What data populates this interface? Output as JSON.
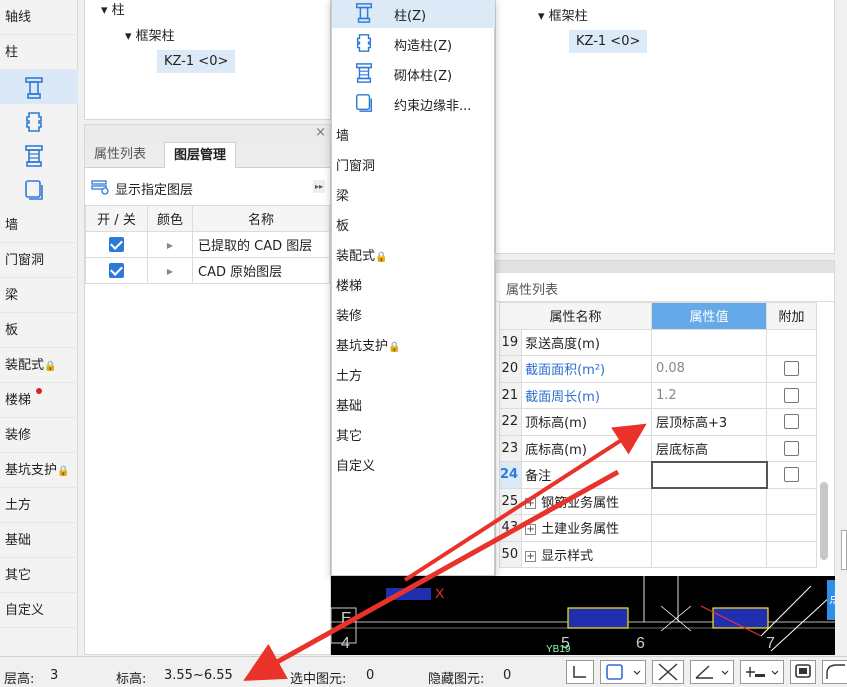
{
  "left_nav": {
    "items": [
      {
        "id": "axis",
        "label": "轴线"
      },
      {
        "id": "column",
        "label": "柱"
      },
      {
        "id": "wall",
        "label": "墙"
      },
      {
        "id": "door-window",
        "label": "门窗洞"
      },
      {
        "id": "beam",
        "label": "梁"
      },
      {
        "id": "slab",
        "label": "板"
      },
      {
        "id": "prefab",
        "label": "装配式",
        "lock": "🔒"
      },
      {
        "id": "stair",
        "label": "楼梯"
      },
      {
        "id": "decoration",
        "label": "装修"
      },
      {
        "id": "pit-support",
        "label": "基坑支护",
        "lock": "🔒"
      },
      {
        "id": "earthwork",
        "label": "土方"
      },
      {
        "id": "foundation",
        "label": "基础"
      },
      {
        "id": "other",
        "label": "其它"
      },
      {
        "id": "custom",
        "label": "自定义"
      }
    ],
    "column_subicons": [
      "column-icon",
      "constructional-column-icon",
      "masonry-column-icon",
      "boundary-member-icon"
    ],
    "accent": "#2f7ad8"
  },
  "left_tree": {
    "root_label": "柱",
    "group_label": "框架柱",
    "selected_item": "KZ-1 <0>"
  },
  "layer_panel": {
    "close_glyph": "×",
    "tabs": [
      "属性列表",
      "图层管理"
    ],
    "active_tab": "图层管理",
    "show_layers_label": "显示指定图层",
    "expand_glyph": "▸▸",
    "columns": [
      "开 / 关",
      "颜色",
      "名称"
    ],
    "rows": [
      {
        "checked": true,
        "name": "已提取的 CAD 图层"
      },
      {
        "checked": true,
        "name": "CAD 原始图层"
      }
    ]
  },
  "popup_menu": {
    "column_items": [
      {
        "label": "柱(Z)",
        "icon": "column-icon",
        "selected": true
      },
      {
        "label": "构造柱(Z)",
        "icon": "constructional-column-icon"
      },
      {
        "label": "砌体柱(Z)",
        "icon": "masonry-column-icon"
      },
      {
        "label": "约束边缘非...",
        "icon": "boundary-member-icon"
      }
    ],
    "categories": [
      {
        "label": "墙"
      },
      {
        "label": "门窗洞"
      },
      {
        "label": "梁"
      },
      {
        "label": "板"
      },
      {
        "label": "装配式",
        "lock": "🔒"
      },
      {
        "label": "楼梯"
      },
      {
        "label": "装修"
      },
      {
        "label": "基坑支护",
        "lock": "🔒"
      },
      {
        "label": "土方"
      },
      {
        "label": "基础"
      },
      {
        "label": "其它"
      },
      {
        "label": "自定义"
      }
    ]
  },
  "right_tree": {
    "group_label": "框架柱",
    "selected_item": "KZ-1 <0>"
  },
  "property_panel": {
    "title": "属性列表",
    "columns": [
      "属性名称",
      "属性值",
      "附加"
    ],
    "header_accent": "#66a9e8",
    "rows": [
      {
        "num": "19",
        "name": "泵送高度(m)",
        "value": "",
        "has_check": false
      },
      {
        "num": "20",
        "name": "截面面积(m²)",
        "value": "0.08",
        "blue": true,
        "gray_value": true,
        "has_check": true
      },
      {
        "num": "21",
        "name": "截面周长(m)",
        "value": "1.2",
        "blue": true,
        "gray_value": true,
        "has_check": true
      },
      {
        "num": "22",
        "name": "顶标高(m)",
        "value": "层顶标高+3",
        "has_check": true
      },
      {
        "num": "23",
        "name": "底标高(m)",
        "value": "层底标高",
        "has_check": true
      },
      {
        "num": "24",
        "name": "备注",
        "value": "",
        "selected": true,
        "has_check": true
      },
      {
        "num": "25",
        "name": "钢筋业务属性",
        "value": "",
        "expandable": true,
        "has_check": false
      },
      {
        "num": "43",
        "name": "土建业务属性",
        "value": "",
        "expandable": true,
        "has_check": false
      },
      {
        "num": "50",
        "name": "显示样式",
        "value": "",
        "expandable": true,
        "has_check": false
      }
    ]
  },
  "canvas": {
    "labels": [
      "E",
      "4",
      "5",
      "6",
      "7",
      "X",
      "YB19"
    ],
    "tooltip": "点"
  },
  "status_bar": {
    "floor_height_label": "层高:",
    "floor_height_value": "3",
    "elevation_label": "标高:",
    "elevation_value": "3.55~6.55",
    "selected_label": "选中图元:",
    "selected_value": "0",
    "hidden_label": "隐藏图元:",
    "hidden_value": "0",
    "tools": [
      "corner-snap-icon",
      "rect-select-icon",
      "cross-select-icon",
      "angle-icon",
      "offset-icon",
      "display-icon",
      "curve-icon"
    ]
  },
  "annotation_colors": {
    "arrow": "#e8322a"
  }
}
